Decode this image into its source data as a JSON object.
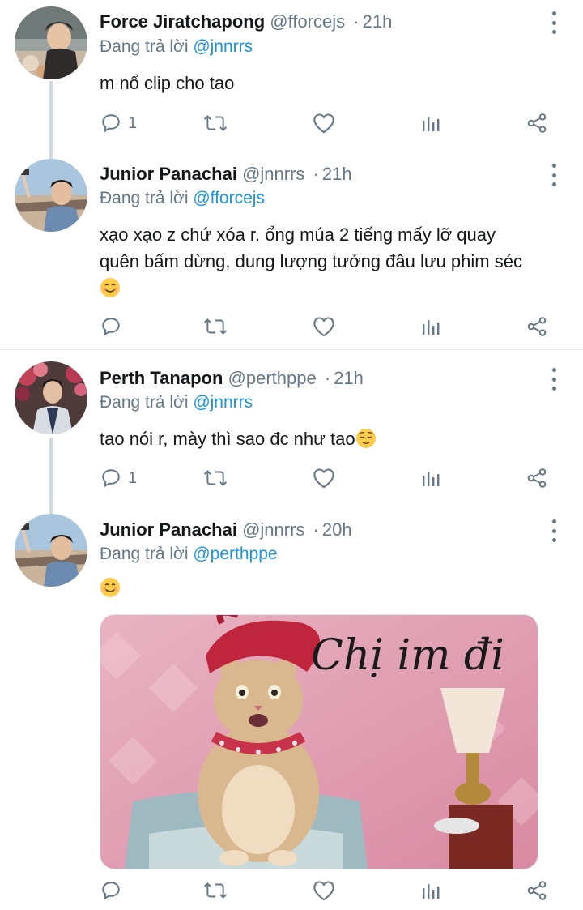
{
  "tweets": [
    {
      "name": "Force Jiratchapong",
      "handle": "@fforcejs",
      "sep": "·",
      "time": "21h",
      "reply_prefix": "Đang trả lời ",
      "reply_to": "@jnnrrs",
      "text": "m nổ clip cho tao",
      "reply_count": "1"
    },
    {
      "name": "Junior Panachai",
      "handle": "@jnnrrs",
      "sep": "·",
      "time": "21h",
      "reply_prefix": "Đang trả lời ",
      "reply_to": "@fforcejs",
      "text_line1": "xạo xạo z chứ xóa r. ổng múa 2 tiếng mấy lỡ quay",
      "text_line2": "quên bấm dừng, dung lượng tưởng đâu lưu phim séc",
      "emoji": "smiling-face"
    },
    {
      "name": "Perth Tanapon",
      "handle": "@perthppe",
      "sep": "·",
      "time": "21h",
      "reply_prefix": "Đang trả lời ",
      "reply_to": "@jnnrrs",
      "text": "tao nói r, mày thì sao đc như tao",
      "emoji": "relieved-face",
      "reply_count": "1"
    },
    {
      "name": "Junior Panachai",
      "handle": "@jnnrrs",
      "sep": "·",
      "time": "20h",
      "reply_prefix": "Đang trả lời ",
      "reply_to": "@perthppe",
      "emoji": "smiling-face",
      "media_caption": "Chị im đi"
    }
  ],
  "icons": {
    "reply": "reply-icon",
    "retweet": "retweet-icon",
    "like": "heart-icon",
    "analytics": "analytics-icon",
    "share": "share-icon",
    "more": "more-icon"
  },
  "colors": {
    "name": "#14171a",
    "secondary": "#657786",
    "mention": "#1b95e0",
    "thread_line": "#cfd9de"
  }
}
